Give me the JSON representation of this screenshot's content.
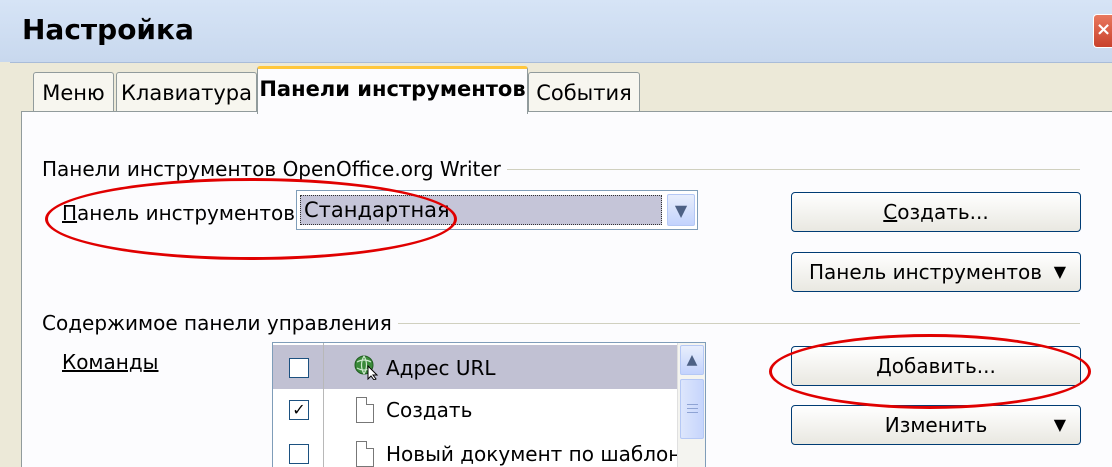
{
  "window": {
    "title": "Настройка",
    "close_glyph": "×"
  },
  "tabs": [
    {
      "label": "Меню",
      "active": false
    },
    {
      "label": "Клавиатура",
      "active": false
    },
    {
      "label": "Панели инструментов",
      "active": true
    },
    {
      "label": "События",
      "active": false
    }
  ],
  "toolbars_group": {
    "title": "Панели инструментов OpenOffice.org Writer",
    "toolbar_label": "Панель инструментов",
    "toolbar_selected": "Стандартная",
    "create_button": "Создать...",
    "toolbar_menu_button": "Панель инструментов"
  },
  "contents_group": {
    "title": "Содержимое панели управления",
    "commands_label": "Команды",
    "add_button": "Добавить...",
    "modify_button": "Изменить",
    "commands": [
      {
        "label": "Адрес URL",
        "checked": false,
        "icon": "globe-icon",
        "selected": true
      },
      {
        "label": "Создать",
        "checked": true,
        "icon": "document-icon",
        "selected": false
      },
      {
        "label": "Новый документ по шаблону",
        "checked": false,
        "icon": "document-icon",
        "selected": false
      }
    ]
  },
  "colors": {
    "highlight_ellipse": "#e00000",
    "tab_active_accent": "#ffc73c",
    "dialog_bg": "#ece9d8"
  }
}
